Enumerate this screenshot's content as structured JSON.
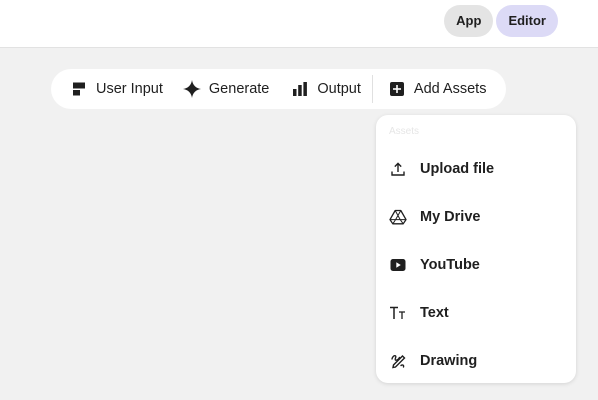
{
  "header": {
    "modes": [
      {
        "label": "App"
      },
      {
        "label": "Editor"
      }
    ],
    "active_mode": "Editor",
    "colors": {
      "editor_active": "#dcdaf6",
      "app_bg": "#e4e4e4"
    }
  },
  "toolbar": {
    "items": [
      {
        "label": "User Input",
        "icon": "user-input-icon"
      },
      {
        "label": "Generate",
        "icon": "sparkle-icon"
      },
      {
        "label": "Output",
        "icon": "bar-chart-icon"
      },
      {
        "label": "Add Assets",
        "icon": "add-box-icon"
      }
    ]
  },
  "assets_menu": {
    "header": "Assets",
    "items": [
      {
        "label": "Upload file",
        "icon": "upload-icon"
      },
      {
        "label": "My Drive",
        "icon": "drive-icon"
      },
      {
        "label": "YouTube",
        "icon": "youtube-icon"
      },
      {
        "label": "Text",
        "icon": "text-format-icon"
      },
      {
        "label": "Drawing",
        "icon": "drawing-icon"
      }
    ]
  }
}
